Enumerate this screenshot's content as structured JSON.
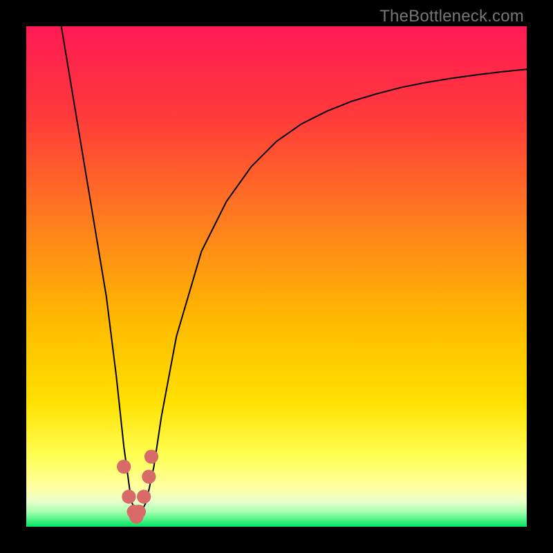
{
  "watermark": "TheBottleneck.com",
  "colors": {
    "frame": "#000000",
    "gradient_top": "#ff1a4d",
    "gradient_mid1": "#ff6b2b",
    "gradient_mid2": "#ffd400",
    "gradient_mid3": "#ffff66",
    "gradient_bottom": "#00e660",
    "curve": "#000000",
    "marker": "#d86a6a"
  },
  "chart_data": {
    "type": "line",
    "title": "",
    "xlabel": "",
    "ylabel": "",
    "xlim": [
      0,
      100
    ],
    "ylim": [
      0,
      100
    ],
    "series": [
      {
        "name": "bottleneck-curve",
        "x": [
          7,
          10,
          13,
          16,
          18,
          19.5,
          21,
          22.5,
          24,
          25.5,
          27,
          30,
          35,
          40,
          45,
          50,
          55,
          60,
          65,
          70,
          75,
          80,
          85,
          90,
          95,
          100
        ],
        "y": [
          100,
          82,
          64,
          46,
          30,
          16,
          5,
          2,
          5,
          12,
          22,
          38,
          55,
          65,
          72,
          77,
          80.5,
          83,
          85,
          86.5,
          87.8,
          88.8,
          89.6,
          90.3,
          90.9,
          91.4
        ]
      }
    ],
    "markers": {
      "name": "highlight-region",
      "x": [
        19.5,
        20.5,
        21.5,
        22,
        22.5,
        23.5,
        24.5,
        25
      ],
      "y": [
        12,
        6,
        3,
        2,
        3,
        6,
        10,
        14
      ]
    },
    "optimum_x": 22,
    "grid": false,
    "legend": false
  }
}
